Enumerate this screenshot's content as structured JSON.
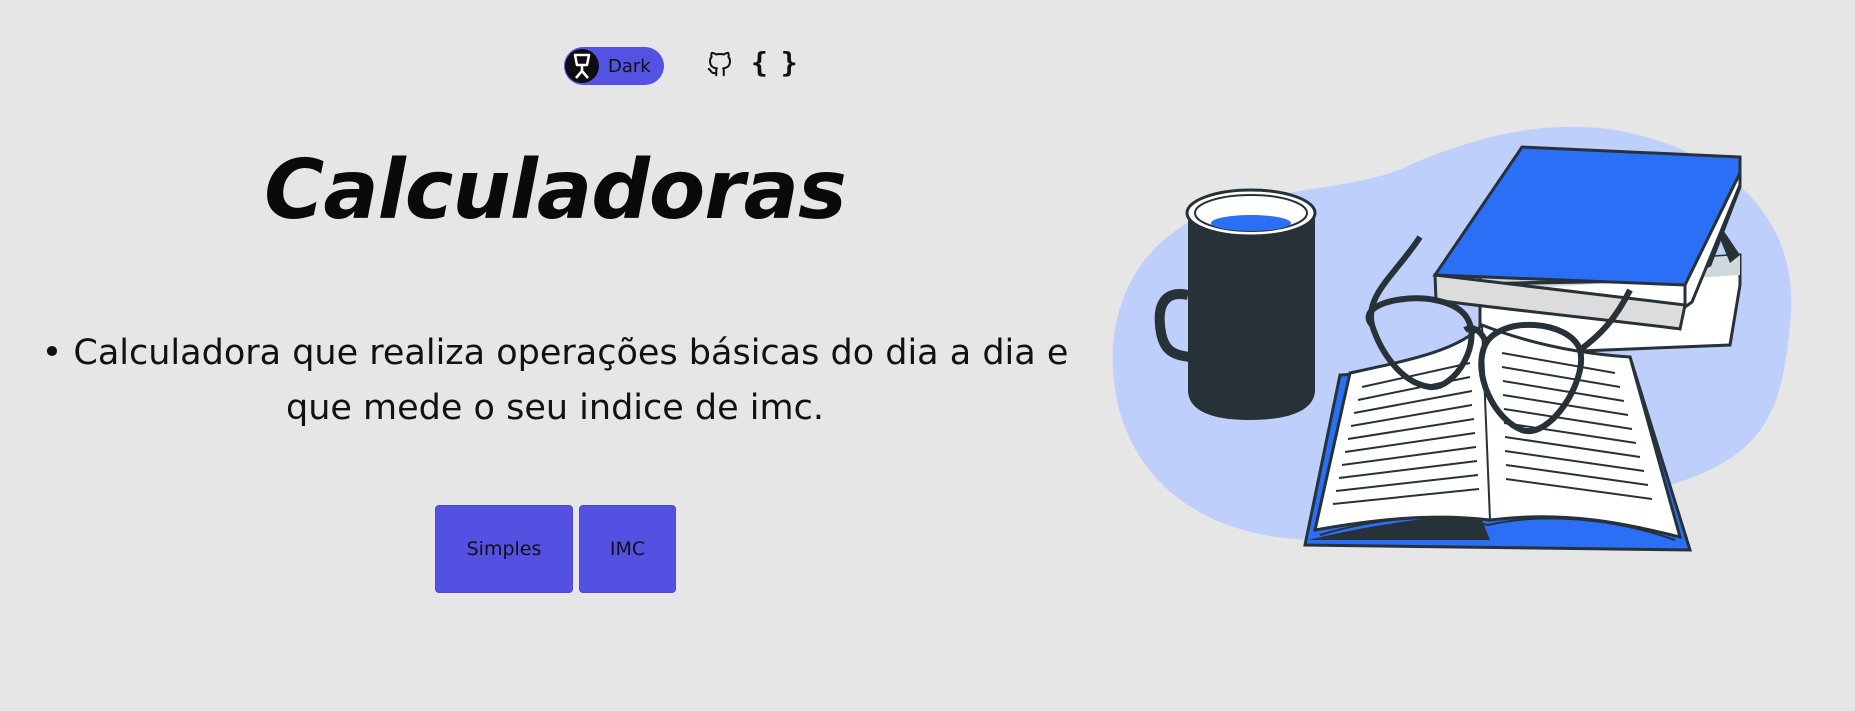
{
  "header": {
    "theme_toggle_label": "Dark",
    "github_icon": "github-icon",
    "code_icon": "braces-icon",
    "code_icon_glyph": "{ }"
  },
  "main": {
    "title": "Calculadoras",
    "description": "• Calculadora que realiza operações básicas do dia a dia e que mede o seu indice de imc.",
    "buttons": [
      {
        "label": "Simples"
      },
      {
        "label": "IMC"
      }
    ]
  },
  "colors": {
    "background": "#e6e6e6",
    "accent": "#5352e2",
    "illustration_blue": "#2a6ff5",
    "illustration_blob": "#bfcffb",
    "illustration_dark": "#263238"
  }
}
